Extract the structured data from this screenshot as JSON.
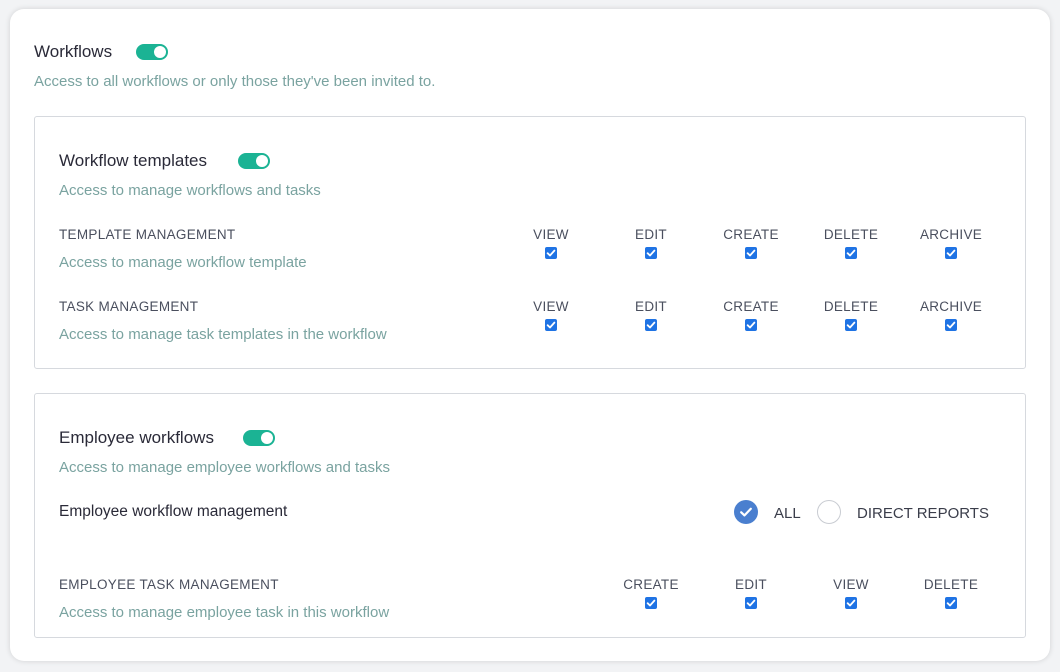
{
  "workflows": {
    "title": "Workflows",
    "description": "Access to all workflows or only those they've been invited to.",
    "enabled": true
  },
  "workflow_templates": {
    "title": "Workflow templates",
    "description": "Access to manage workflows and tasks",
    "enabled": true,
    "rows": [
      {
        "label": "TEMPLATE MANAGEMENT",
        "description": "Access to manage workflow template",
        "columns": [
          "VIEW",
          "EDIT",
          "CREATE",
          "DELETE",
          "ARCHIVE"
        ],
        "checked": [
          true,
          true,
          true,
          true,
          true
        ]
      },
      {
        "label": "TASK MANAGEMENT",
        "description": "Access to manage task templates in the workflow",
        "columns": [
          "VIEW",
          "EDIT",
          "CREATE",
          "DELETE",
          "ARCHIVE"
        ],
        "checked": [
          true,
          true,
          true,
          true,
          true
        ]
      }
    ]
  },
  "employee_workflows": {
    "title": "Employee workflows",
    "description": "Access to manage employee workflows and tasks",
    "enabled": true,
    "management": {
      "label": "Employee workflow management",
      "options": [
        "ALL",
        "DIRECT REPORTS"
      ],
      "selected": "ALL"
    },
    "task_management": {
      "label": "EMPLOYEE TASK MANAGEMENT",
      "description": "Access to manage employee task in this workflow",
      "columns": [
        "CREATE",
        "EDIT",
        "VIEW",
        "DELETE"
      ],
      "checked": [
        true,
        true,
        true,
        true
      ]
    }
  },
  "colors": {
    "toggle_on": "#1bb394",
    "checkbox": "#1f73e4",
    "radio_selected": "#4a7fcf",
    "description_text": "#7aa3a0"
  }
}
